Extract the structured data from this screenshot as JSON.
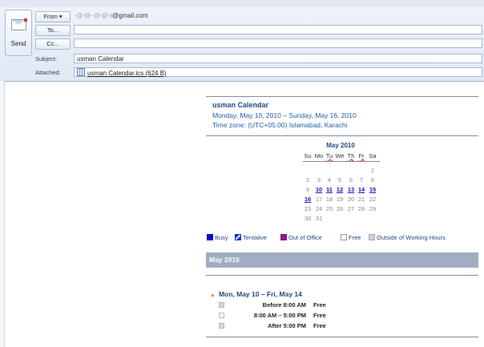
{
  "compose": {
    "send_label": "Send",
    "from_button": "From ▾",
    "from_email_masked": "·@·@··@·@·s",
    "from_email_domain": "@gmail.com",
    "to_button": "To...",
    "cc_button": "Cc...",
    "to_value": "",
    "cc_value": "",
    "subject_label": "Subject:",
    "subject_value": "usman Calendar",
    "attached_label": "Attached:",
    "attachment_name": "usman Calendar.ics (624 B)"
  },
  "calendar": {
    "title": "usman Calendar",
    "range": "Monday, May 10, 2010 – Sunday, May 16, 2010",
    "timezone": "Time zone: (UTC+05:00) Islamabad, Karachi",
    "mini": {
      "month_label": "May 2010",
      "weekdays": [
        "Su",
        "Mo",
        "Tu",
        "We",
        "Th",
        "Fr",
        "Sa"
      ],
      "days": [
        [
          "",
          "",
          "",
          "",
          "",
          "",
          "1"
        ],
        [
          "2",
          "3",
          "4",
          "5",
          "6",
          "7",
          "8"
        ],
        [
          "9",
          "10",
          "11",
          "12",
          "13",
          "14",
          "15"
        ],
        [
          "16",
          "17",
          "18",
          "19",
          "20",
          "21",
          "22"
        ],
        [
          "23",
          "24",
          "25",
          "26",
          "27",
          "28",
          "29"
        ],
        [
          "30",
          "31",
          "",
          "",
          "",
          "",
          ""
        ]
      ],
      "highlighted": [
        "10",
        "11",
        "12",
        "13",
        "14",
        "15",
        "16"
      ]
    },
    "legend": [
      {
        "label": "Busy",
        "color": "#0a0ad0"
      },
      {
        "label": "Tentative",
        "color": "#1a3ad0"
      },
      {
        "label": "Out of Office",
        "color": "#8e168e"
      },
      {
        "label": "Free",
        "color": "#ffffff"
      },
      {
        "label": "Outside of Working Hours",
        "color": "#d0d0d0"
      }
    ],
    "month_header": "May 2010",
    "week": {
      "title": "Mon, May 10 – Fri, May 14",
      "slots": [
        {
          "time": "Before 8:00 AM",
          "status": "Free"
        },
        {
          "time": "8:00 AM – 5:00 PM",
          "status": "Free"
        },
        {
          "time": "After 5:00 PM",
          "status": "Free"
        }
      ]
    }
  }
}
